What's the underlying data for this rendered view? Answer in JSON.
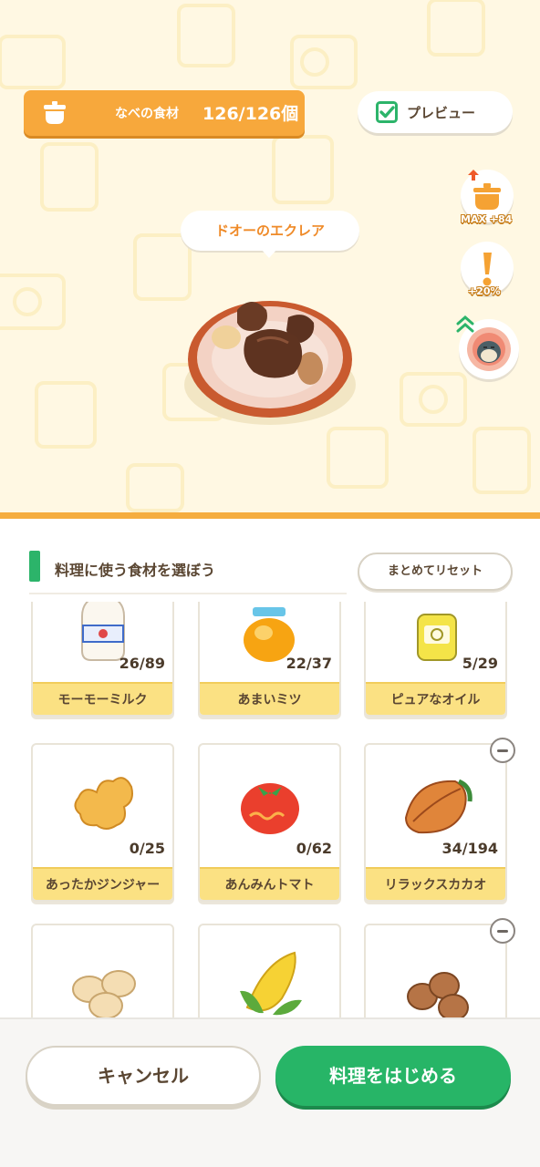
{
  "header": {
    "pot_label": "なべの食材",
    "pot_count": "126/126個",
    "preview_label": "プレビュー",
    "preview_checked": true
  },
  "side_buttons": [
    {
      "icon": "pot-upgrade-icon",
      "caption": "MAX +84"
    },
    {
      "icon": "exclamation-icon",
      "caption": "+20%"
    },
    {
      "icon": "snorlax-avatar-icon",
      "caption": ""
    }
  ],
  "dish": {
    "name": "ドオーのエクレア",
    "icon": "chocolate-eclair-dish-icon"
  },
  "section": {
    "title": "料理に使う食材を選ぼう",
    "reset_label": "まとめてリセット"
  },
  "ingredients": [
    {
      "name": "モーモーミルク",
      "count": "26/89",
      "icon": "milk-bottle-icon"
    },
    {
      "name": "あまいミツ",
      "count": "22/37",
      "icon": "honey-jar-icon"
    },
    {
      "name": "ピュアなオイル",
      "count": "5/29",
      "icon": "oil-bottle-icon"
    },
    {
      "name": "あったかジンジャー",
      "count": "0/25",
      "icon": "ginger-icon"
    },
    {
      "name": "あんみんトマト",
      "count": "0/62",
      "icon": "tomato-icon"
    },
    {
      "name": "リラックスカカオ",
      "count": "34/194",
      "icon": "cacao-icon",
      "removable": true
    },
    {
      "name": "",
      "count": "",
      "icon": "soybeans-icon"
    },
    {
      "name": "",
      "count": "",
      "icon": "corn-icon"
    },
    {
      "name": "",
      "count": "",
      "icon": "mushroom-nuts-icon",
      "removable": true
    }
  ],
  "footer": {
    "cancel_label": "キャンセル",
    "start_label": "料理をはじめる"
  },
  "colors": {
    "accent_orange": "#f7a83c",
    "start_green": "#27b567",
    "label_yellow": "#fbe183",
    "background_cream": "#fff8e3"
  }
}
